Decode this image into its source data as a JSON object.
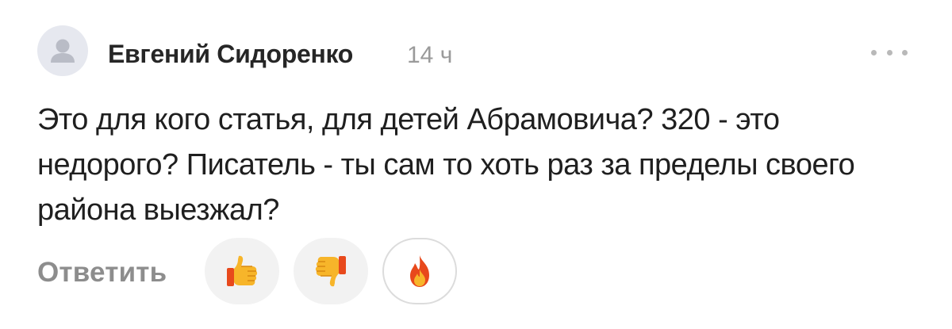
{
  "comment": {
    "author": "Евгений Сидоренко",
    "time": "14 ч",
    "text": "Это для кого статья, для детей Абрамовича? 320 - это недорого? Писатель - ты сам то хоть раз за пределы своего района выезжал?",
    "reply_label": "Ответить",
    "reactions": [
      {
        "icon": "thumbs-up-icon",
        "style": "filled"
      },
      {
        "icon": "thumbs-down-icon",
        "style": "filled"
      },
      {
        "icon": "fire-icon",
        "style": "outlined"
      }
    ],
    "more_icon": "more-dots-icon"
  },
  "colors": {
    "author": "#262626",
    "time": "#9a9a9a",
    "reply": "#8d8d8d",
    "avatar_bg": "#e6e8ef",
    "emoji_yellow": "#f7b52a",
    "fire_red": "#e8491c"
  }
}
